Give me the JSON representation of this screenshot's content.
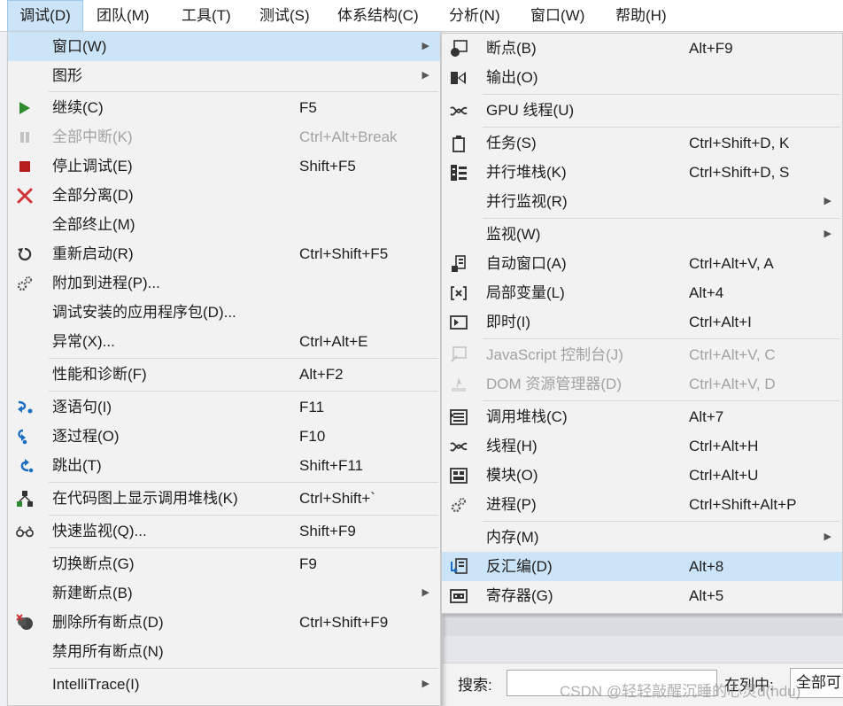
{
  "menubar": {
    "items": [
      "调试(D)",
      "团队(M)",
      "工具(T)",
      "测试(S)",
      "体系结构(C)",
      "分析(N)",
      "窗口(W)",
      "帮助(H)"
    ]
  },
  "debug_menu": {
    "items": [
      {
        "label": "窗口(W)",
        "shortcut": "",
        "submenu": true,
        "icon": "",
        "highlighted": true
      },
      {
        "label": "图形",
        "shortcut": "",
        "submenu": true,
        "icon": ""
      },
      {
        "label": "继续(C)",
        "shortcut": "F5",
        "icon": "play-icon"
      },
      {
        "label": "全部中断(K)",
        "shortcut": "Ctrl+Alt+Break",
        "icon": "pause-icon",
        "disabled": true
      },
      {
        "label": "停止调试(E)",
        "shortcut": "Shift+F5",
        "icon": "stop-icon"
      },
      {
        "label": "全部分离(D)",
        "shortcut": "",
        "icon": "detach-icon"
      },
      {
        "label": "全部终止(M)",
        "shortcut": "",
        "icon": ""
      },
      {
        "label": "重新启动(R)",
        "shortcut": "Ctrl+Shift+F5",
        "icon": "restart-icon"
      },
      {
        "label": "附加到进程(P)...",
        "shortcut": "",
        "icon": "gears-icon"
      },
      {
        "label": "调试安装的应用程序包(D)...",
        "shortcut": "",
        "icon": ""
      },
      {
        "label": "异常(X)...",
        "shortcut": "Ctrl+Alt+E",
        "icon": ""
      },
      {
        "label": "性能和诊断(F)",
        "shortcut": "Alt+F2",
        "icon": ""
      },
      {
        "label": "逐语句(I)",
        "shortcut": "F11",
        "icon": "step-into-icon"
      },
      {
        "label": "逐过程(O)",
        "shortcut": "F10",
        "icon": "step-over-icon"
      },
      {
        "label": "跳出(T)",
        "shortcut": "Shift+F11",
        "icon": "step-out-icon"
      },
      {
        "label": "在代码图上显示调用堆栈(K)",
        "shortcut": "Ctrl+Shift+`",
        "icon": "code-map-icon"
      },
      {
        "label": "快速监视(Q)...",
        "shortcut": "Shift+F9",
        "icon": "glasses-icon"
      },
      {
        "label": "切换断点(G)",
        "shortcut": "F9",
        "icon": ""
      },
      {
        "label": "新建断点(B)",
        "shortcut": "",
        "submenu": true,
        "icon": ""
      },
      {
        "label": "删除所有断点(D)",
        "shortcut": "Ctrl+Shift+F9",
        "icon": "delete-breakpoints-icon"
      },
      {
        "label": "禁用所有断点(N)",
        "shortcut": "",
        "icon": ""
      },
      {
        "label": "IntelliTrace(I)",
        "shortcut": "",
        "submenu": true,
        "icon": ""
      }
    ]
  },
  "window_menu": {
    "items": [
      {
        "label": "断点(B)",
        "shortcut": "Alt+F9",
        "icon": "breakpoints-window-icon"
      },
      {
        "label": "输出(O)",
        "shortcut": "",
        "icon": "output-icon"
      },
      {
        "label": "GPU 线程(U)",
        "shortcut": "",
        "icon": "gpu-threads-icon"
      },
      {
        "label": "任务(S)",
        "shortcut": "Ctrl+Shift+D, K",
        "icon": "tasks-icon"
      },
      {
        "label": "并行堆栈(K)",
        "shortcut": "Ctrl+Shift+D, S",
        "icon": "parallel-stacks-icon"
      },
      {
        "label": "并行监视(R)",
        "shortcut": "",
        "submenu": true,
        "icon": ""
      },
      {
        "label": "监视(W)",
        "shortcut": "",
        "submenu": true,
        "icon": ""
      },
      {
        "label": "自动窗口(A)",
        "shortcut": "Ctrl+Alt+V, A",
        "icon": "autos-icon"
      },
      {
        "label": "局部变量(L)",
        "shortcut": "Alt+4",
        "icon": "locals-icon"
      },
      {
        "label": "即时(I)",
        "shortcut": "Ctrl+Alt+I",
        "icon": "immediate-icon"
      },
      {
        "label": "JavaScript 控制台(J)",
        "shortcut": "Ctrl+Alt+V, C",
        "icon": "js-console-icon",
        "disabled": true
      },
      {
        "label": "DOM 资源管理器(D)",
        "shortcut": "Ctrl+Alt+V, D",
        "icon": "dom-explorer-icon",
        "disabled": true
      },
      {
        "label": "调用堆栈(C)",
        "shortcut": "Alt+7",
        "icon": "call-stack-icon"
      },
      {
        "label": "线程(H)",
        "shortcut": "Ctrl+Alt+H",
        "icon": "threads-icon"
      },
      {
        "label": "模块(O)",
        "shortcut": "Ctrl+Alt+U",
        "icon": "modules-icon"
      },
      {
        "label": "进程(P)",
        "shortcut": "Ctrl+Shift+Alt+P",
        "icon": "processes-icon"
      },
      {
        "label": "内存(M)",
        "shortcut": "",
        "submenu": true,
        "icon": ""
      },
      {
        "label": "反汇编(D)",
        "shortcut": "Alt+8",
        "icon": "disassembly-icon",
        "highlighted": true
      },
      {
        "label": "寄存器(G)",
        "shortcut": "Alt+5",
        "icon": "registers-icon"
      }
    ]
  },
  "search_bar": {
    "label": "搜索:",
    "value": "",
    "scope_label": "在列中:",
    "scope_value": "全部可"
  },
  "watermark": "CSDN @轻轻敲醒沉睡的心灵d(hdu)",
  "colors": {
    "highlight": "#cce4f7",
    "play": "#2e8b2e",
    "stop": "#b81c1c",
    "detach": "#d13438",
    "step": "#1b6ec2"
  }
}
